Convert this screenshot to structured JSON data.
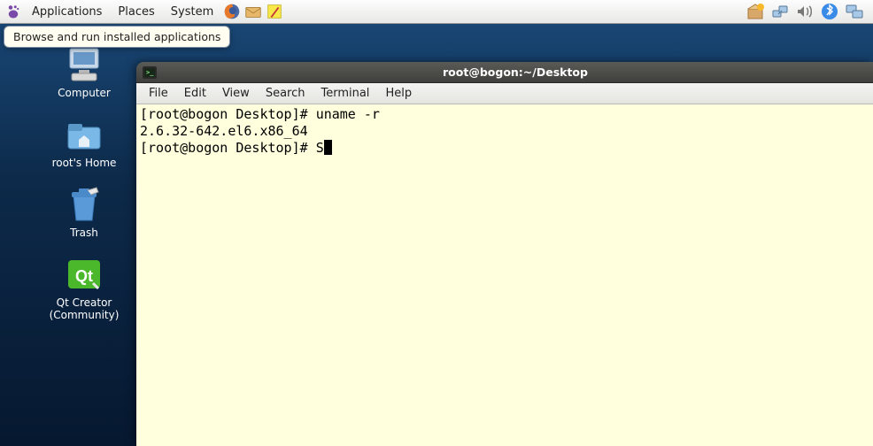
{
  "panel": {
    "menus": {
      "applications": "Applications",
      "places": "Places",
      "system": "System"
    },
    "tooltip": "Browse and run installed applications"
  },
  "desktop": {
    "icons": [
      {
        "label": "Computer"
      },
      {
        "label": "root's Home"
      },
      {
        "label": "Trash"
      },
      {
        "label": "Qt Creator (Community)"
      }
    ]
  },
  "terminal": {
    "title": "root@bogon:~/Desktop",
    "menubar": {
      "file": "File",
      "edit": "Edit",
      "view": "View",
      "search": "Search",
      "terminal": "Terminal",
      "help": "Help"
    },
    "lines": {
      "l0_prompt": "[root@bogon Desktop]# ",
      "l0_cmd": "uname -r",
      "l1_out": "2.6.32-642.el6.x86_64",
      "l2_prompt": "[root@bogon Desktop]# ",
      "l2_input": "S"
    }
  }
}
